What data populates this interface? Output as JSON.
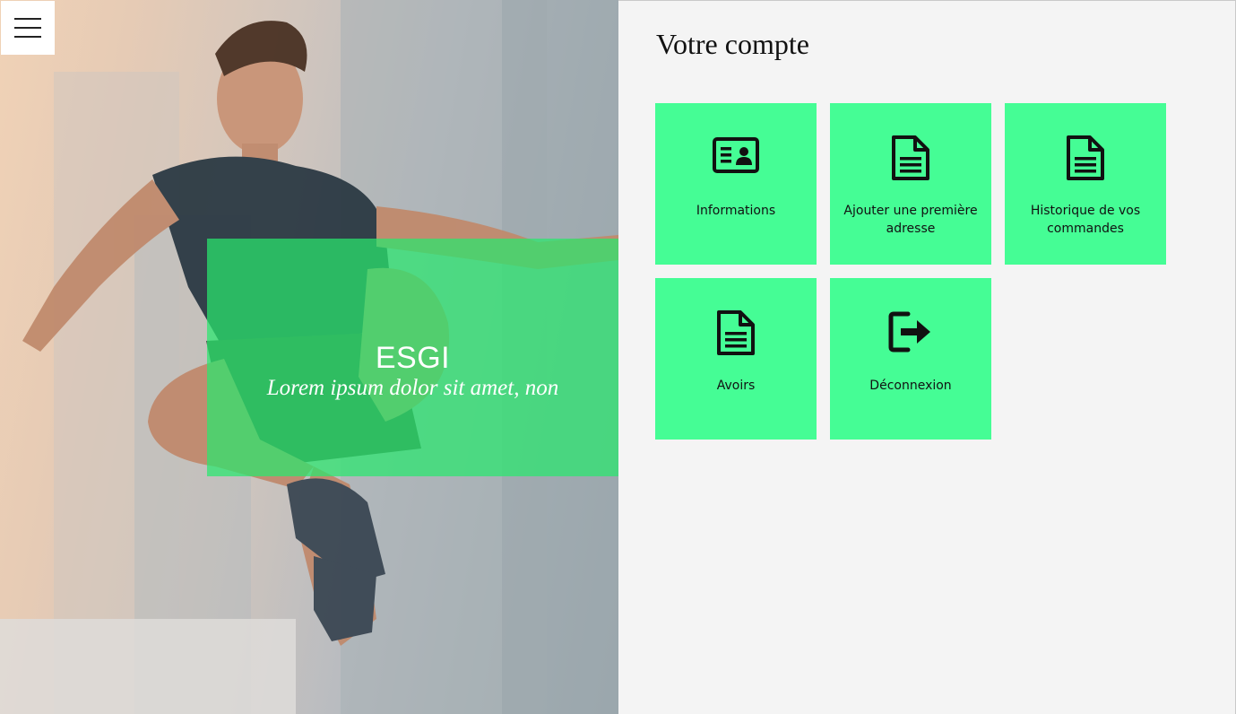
{
  "hero": {
    "title": "ESGI",
    "subtitle": "Lorem ipsum dolor sit amet, non",
    "overlay_color": "#28e86e"
  },
  "menu": {
    "icon": "hamburger-icon"
  },
  "account": {
    "title": "Votre compte",
    "tile_color": "#45fd95",
    "tiles": [
      {
        "label": "Informations",
        "icon": "id-card-icon"
      },
      {
        "label": "Ajouter une première adresse",
        "icon": "document-icon"
      },
      {
        "label": "Historique de vos commandes",
        "icon": "document-icon"
      },
      {
        "label": "Avoirs",
        "icon": "document-icon"
      },
      {
        "label": "Déconnexion",
        "icon": "sign-out-icon"
      }
    ]
  }
}
